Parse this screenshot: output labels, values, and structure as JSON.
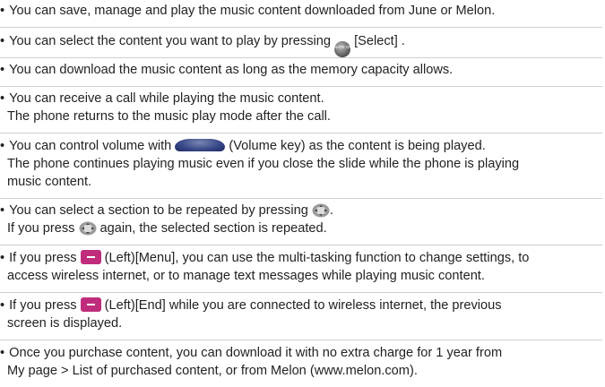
{
  "bullets": [
    {
      "lines": [
        {
          "segments": [
            {
              "text": "You can save, manage and play the music content downloaded from June or Melon."
            }
          ]
        }
      ]
    },
    {
      "lines": [
        {
          "segments": [
            {
              "text": "You can select the content you want to play by pressing "
            },
            {
              "icon": "select-key-icon",
              "icon_text": "NATE ON"
            },
            {
              "text": " [Select] ."
            }
          ]
        }
      ]
    },
    {
      "lines": [
        {
          "segments": [
            {
              "text": "You can download the music content as long as the memory capacity allows."
            }
          ]
        }
      ]
    },
    {
      "lines": [
        {
          "segments": [
            {
              "text": "You can receive a call while playing the music content."
            }
          ]
        },
        {
          "segments": [
            {
              "text": "The phone returns to the music play mode after the call."
            }
          ]
        }
      ]
    },
    {
      "lines": [
        {
          "segments": [
            {
              "text": "You can control volume with "
            },
            {
              "icon": "volume-key-icon"
            },
            {
              "text": " (Volume key) as the content is being played."
            }
          ]
        },
        {
          "segments": [
            {
              "text": "The phone continues playing music even if you close the slide while the phone is playing"
            }
          ]
        },
        {
          "segments": [
            {
              "text": "music content."
            }
          ]
        }
      ]
    },
    {
      "lines": [
        {
          "segments": [
            {
              "text": "You can select a section to be repeated by pressing "
            },
            {
              "icon": "nav-key-icon"
            },
            {
              "text": "."
            }
          ]
        },
        {
          "segments": [
            {
              "text": "If you press "
            },
            {
              "icon": "nav-key-icon"
            },
            {
              "text": " again, the selected section is repeated."
            }
          ]
        }
      ]
    },
    {
      "lines": [
        {
          "segments": [
            {
              "text": "If you press "
            },
            {
              "icon": "left-softkey-icon"
            },
            {
              "text": " (Left)[Menu], you can use the multi-tasking function to change settings, to"
            }
          ]
        },
        {
          "segments": [
            {
              "text": "access wireless internet, or to manage text messages while playing music content."
            }
          ]
        }
      ]
    },
    {
      "lines": [
        {
          "segments": [
            {
              "text": "If you press "
            },
            {
              "icon": "left-softkey-icon"
            },
            {
              "text": " (Left)[End] while you are connected to wireless internet, the previous"
            }
          ]
        },
        {
          "segments": [
            {
              "text": "screen is displayed."
            }
          ]
        }
      ]
    },
    {
      "lines": [
        {
          "segments": [
            {
              "text": "Once you purchase content, you can download it with no extra charge for 1 year from"
            }
          ]
        },
        {
          "segments": [
            {
              "text": "My page > List of purchased content, or from Melon (www.melon.com)."
            }
          ]
        }
      ]
    }
  ],
  "colors": {
    "text": "#222222",
    "divider": "#cfcfcf",
    "softkey": "#c02c7c",
    "volume_key": "#3a4a8a"
  }
}
